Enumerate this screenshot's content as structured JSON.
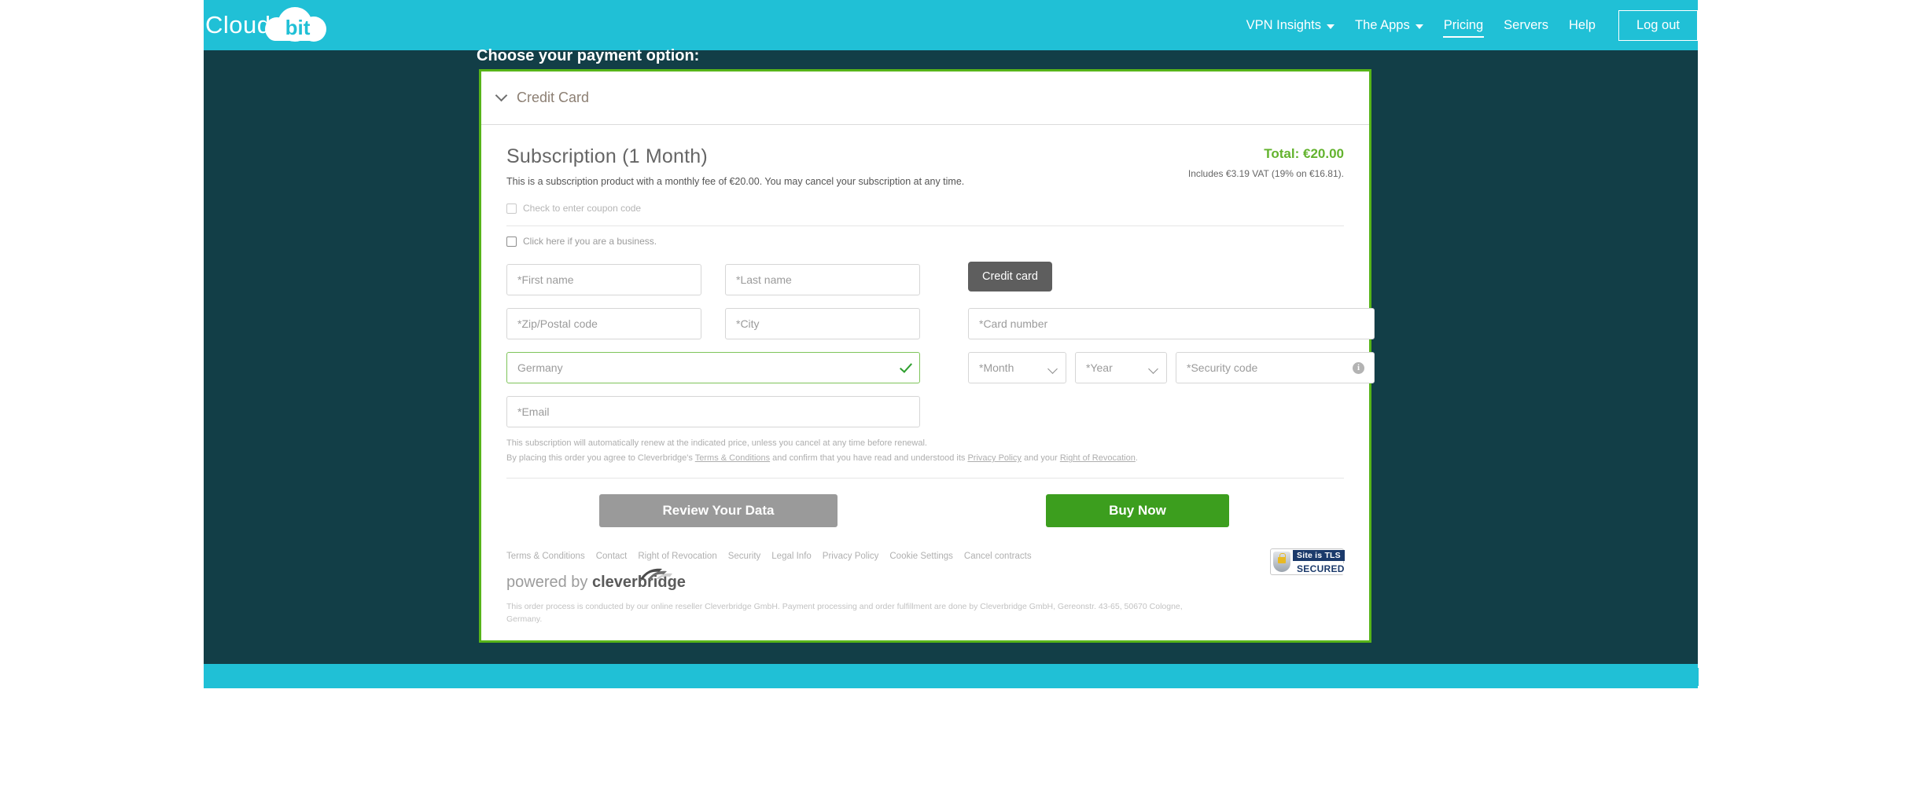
{
  "brand": {
    "logo_text": "Cloud",
    "logo_badge": "bit",
    "teal": "#20c0d6",
    "dark": "#123e47",
    "green": "#57b419"
  },
  "nav": {
    "items": [
      {
        "label": "VPN Insights",
        "has_caret": true,
        "active": false
      },
      {
        "label": "The Apps",
        "has_caret": true,
        "active": false
      },
      {
        "label": "Pricing",
        "has_caret": false,
        "active": true
      },
      {
        "label": "Servers",
        "has_caret": false,
        "active": false
      },
      {
        "label": "Help",
        "has_caret": false,
        "active": false
      }
    ],
    "logout_label": "Log out"
  },
  "page": {
    "choose_title": "Choose your payment option:"
  },
  "payment_panel": {
    "method_label": "Credit Card",
    "chevron_icon": "chevron-down-icon"
  },
  "subscription": {
    "title": "Subscription (1 Month)",
    "description": "This is a subscription product with a monthly fee of €20.00. You may cancel your subscription at any time.",
    "total_label": "Total: €20.00",
    "vat_label": "Includes €3.19 VAT (19% on €16.81).",
    "coupon_checkbox_label": "Check to enter coupon code",
    "business_checkbox_label": "Click here if you are a business."
  },
  "form": {
    "first_name_placeholder": "*First name",
    "last_name_placeholder": "*Last name",
    "zip_placeholder": "*Zip/Postal code",
    "city_placeholder": "*City",
    "country_value": "Germany",
    "country_valid_icon": "checkmark-icon",
    "email_placeholder": "*Email",
    "credit_card_tab_label": "Credit card",
    "card_number_placeholder": "*Card number",
    "month_placeholder": "*Month",
    "year_placeholder": "*Year",
    "security_code_placeholder": "*Security code",
    "security_info_icon": "info-icon"
  },
  "legal": {
    "renew_notice": "This subscription will automatically renew at the indicated price, unless you cancel at any time before renewal.",
    "agree_prefix": "By placing this order you agree to Cleverbridge's ",
    "terms_link": "Terms & Conditions",
    "agree_mid": " and confirm that you have read and understood its ",
    "privacy_link": "Privacy Policy",
    "agree_and": " and your ",
    "revocation_link": "Right of Revocation",
    "agree_suffix": "."
  },
  "actions": {
    "review_label": "Review Your Data",
    "buy_label": "Buy Now"
  },
  "footer": {
    "links": [
      "Terms & Conditions",
      "Contact",
      "Right of Revocation",
      "Security",
      "Legal Info",
      "Privacy Policy",
      "Cookie Settings",
      "Cancel contracts"
    ],
    "powered_by": "powered by ",
    "reseller_name": "cleverbridge",
    "disclaimer": "This order process is conducted by our online reseller Cleverbridge GmbH. Payment processing and order fulfillment are done by Cleverbridge GmbH, Gereonstr. 43-65, 50670 Cologne, Germany.",
    "tls_line1": "Site is TLS",
    "tls_line2": "SECURED",
    "tls_icon": "lock-shield-icon"
  }
}
